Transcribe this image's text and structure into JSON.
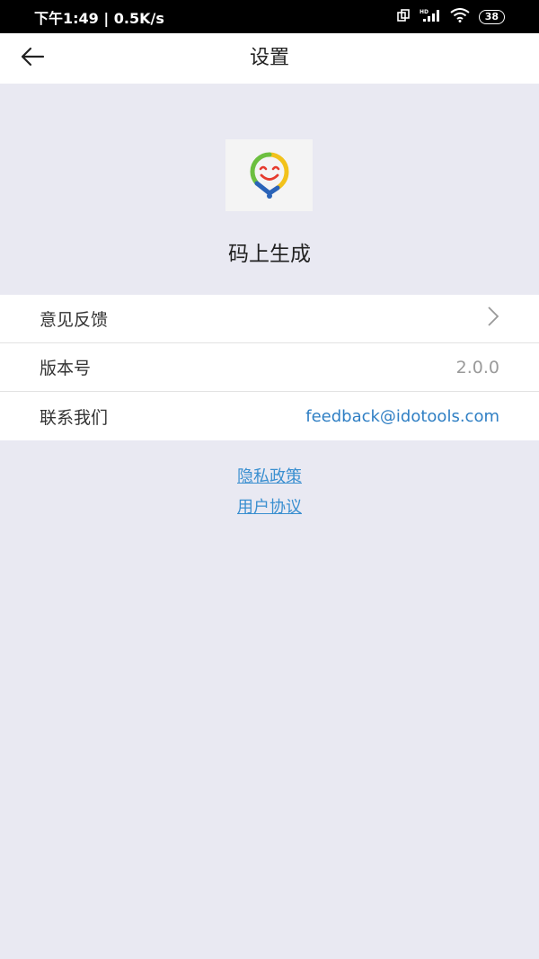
{
  "status_bar": {
    "time_speed": "下午1:49 | 0.5K/s",
    "battery": "38",
    "icons": [
      "sim-icon",
      "hd-signal-icon",
      "wifi-icon",
      "battery-icon"
    ]
  },
  "app_bar": {
    "title": "设置",
    "back_icon": "arrow-left-icon"
  },
  "app_info": {
    "name": "码上生成",
    "logo_icon": "smiley-pin-logo"
  },
  "settings": {
    "feedback": {
      "label": "意见反馈",
      "icon": "chevron-right-icon"
    },
    "version": {
      "label": "版本号",
      "value": "2.0.0"
    },
    "contact": {
      "label": "联系我们",
      "value": "feedback@idotools.com"
    }
  },
  "links": {
    "privacy": "隐私政策",
    "agreement": "用户协议"
  },
  "colors": {
    "background": "#e9e9f2",
    "link": "#3a8fd0",
    "logo_yellow": "#f2c21b",
    "logo_green": "#6cbf3f",
    "logo_blue": "#2a63b8",
    "logo_red": "#e63b2e"
  }
}
